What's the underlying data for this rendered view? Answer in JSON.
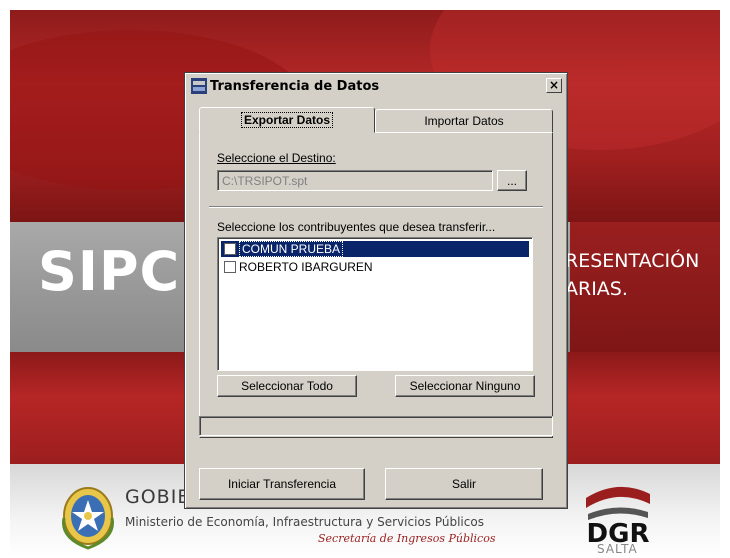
{
  "background": {
    "brand_text": "SIPC",
    "presentation_line1": "RESENTACIÓN",
    "presentation_line2": "ARIAS.",
    "gobierno_text": "GOBIE",
    "ministry_text": "Ministerio de Economía, Infraestructura y Servicios Públicos",
    "secretaria_text": "Secretaría de Ingresos Públicos",
    "dgr_logo_text": "DGR",
    "dgr_location": "SALTA",
    "colors": {
      "brand_red": "#a82323",
      "grey_band": "#9a9a9a"
    }
  },
  "dialog": {
    "title": "Transferencia de Datos",
    "close_glyph": "×",
    "tabs": [
      {
        "label": "Exportar Datos",
        "active": true
      },
      {
        "label": "Importar Datos",
        "active": false
      }
    ],
    "destination": {
      "label": "Seleccione el Destino:",
      "value": "C:\\TRSIPOT.spt",
      "browse_label": "..."
    },
    "contributors": {
      "label": "Seleccione los contribuyentes que desea transferir...",
      "items": [
        {
          "name": "COMUN PRUEBA",
          "checked": false,
          "selected": true
        },
        {
          "name": "ROBERTO IBARGUREN",
          "checked": false,
          "selected": false
        }
      ],
      "select_all_label": "Seleccionar Todo",
      "select_none_label": "Seleccionar Ninguno"
    },
    "progress": 0,
    "start_label": "Iniciar Transferencia",
    "exit_label": "Salir",
    "colors": {
      "selection": "#0a246a",
      "face": "#d4d0c8"
    }
  }
}
